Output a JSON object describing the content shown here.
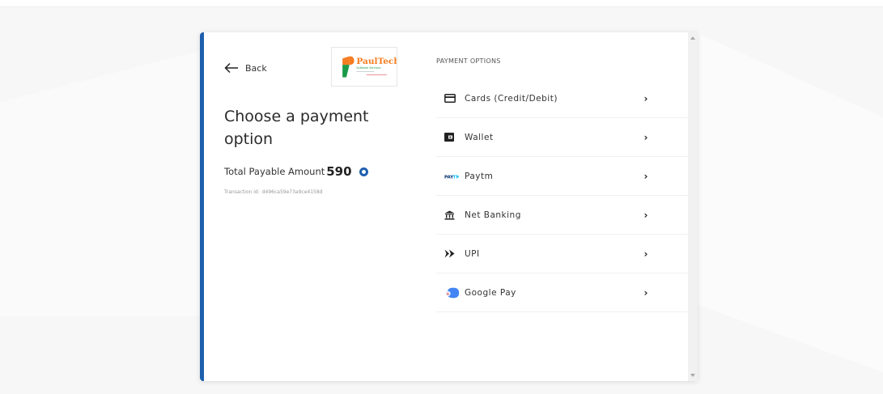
{
  "left_panel": {
    "back_label": "Back",
    "logo_text": "PaulTech",
    "logo_subtext": "Software Services",
    "title": "Choose a payment option",
    "amount_label": "Total Payable Amount",
    "currency_symbol": "",
    "amount_value": "590",
    "transaction_label": "Transaction id:",
    "transaction_id": "d496ca59e73a9ce4158d"
  },
  "right_panel": {
    "heading": "PAYMENT OPTIONS",
    "options": [
      {
        "label": "Cards (Credit/Debit)",
        "icon": "card-icon"
      },
      {
        "label": "Wallet",
        "icon": "wallet-icon"
      },
      {
        "label": "Paytm",
        "icon": "paytm-icon",
        "icon_text": "PAYTM"
      },
      {
        "label": "Net Banking",
        "icon": "bank-icon"
      },
      {
        "label": "UPI",
        "icon": "upi-icon"
      },
      {
        "label": "Google Pay",
        "icon": "google-pay-icon",
        "icon_text": "G Pay"
      }
    ],
    "chevron": "›"
  },
  "colors": {
    "accent": "#1e5fae",
    "paytm_blue": "#00baf2",
    "paytm_dark": "#002e6e",
    "gpay_blue": "#4285f4"
  }
}
